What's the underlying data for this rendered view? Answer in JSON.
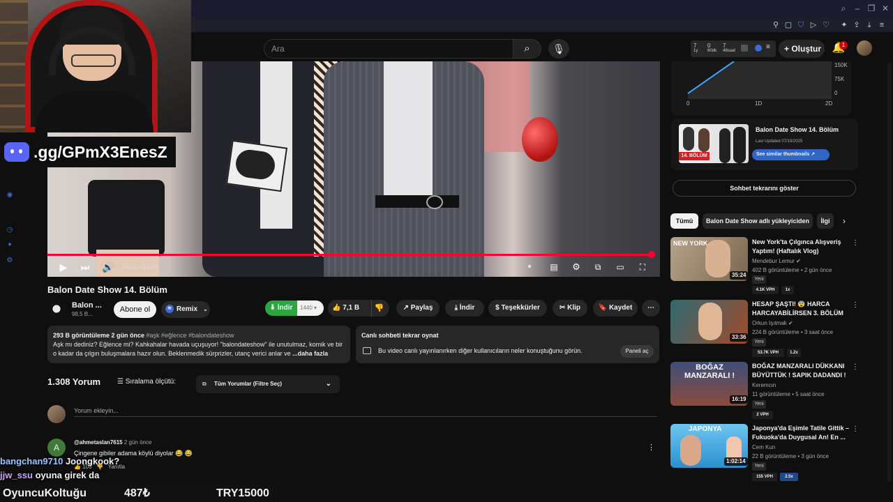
{
  "header": {
    "search_placeholder": "Ara",
    "create_label": "Oluştur",
    "notif_count": "1",
    "stats": [
      {
        "value": "7",
        "label": "1y"
      },
      {
        "value": "0",
        "label": "60dk."
      },
      {
        "value": "7",
        "label": "48saat"
      }
    ]
  },
  "overlay": {
    "discord_text": ".gg/GPmX3EnesZ",
    "chat": [
      {
        "user": "bangchan9710",
        "text": "Joongkook?"
      },
      {
        "user": "jjw_ssu",
        "text": "oyuna girek da"
      }
    ],
    "bottom_left": "OyuncuKoltuğu",
    "bottom_mid": "487₺",
    "bottom_right": "TRY15000"
  },
  "player": {
    "progress": 0.995,
    "time": "44:42 / 44:49"
  },
  "video": {
    "title": "Balon Date Show 14. Bölüm",
    "channel": "Balon ...",
    "subs": "98,5 B...",
    "subscribe_label": "Abone ol",
    "remix_label": "Remix",
    "download_label": "İndir",
    "download_count": "1440",
    "likes": "7,1 B",
    "share_label": "Paylaş",
    "download2_label": "İndir",
    "thanks_label": "Teşekkürler",
    "clip_label": "Klip",
    "save_label": "Kaydet"
  },
  "description": {
    "meta": "293 B görüntüleme  2 gün önce",
    "tags": "#aşk #eğlence #balondateshow",
    "text": "Aşk mı dediniz? Eğlence mi? Kahkahalar havada uçuşuyor! \"balondateshow\" ile unutulmaz, komik ve bir o kadar da çılgın buluşmalara hazır olun. Beklenmedik sürprizler, utanç verici anlar ve ",
    "more": "...daha fazla"
  },
  "live_chat": {
    "title": "Canlı sohbeti tekrar oynat",
    "text": "Bu video canlı yayınlanırken diğer kullanıcıların neler konuştuğunu görün.",
    "button": "Paneli aç"
  },
  "comments": {
    "count": "1.308 Yorum",
    "sort_label": "Sıralama ölçütü:",
    "filter_label": "Tüm Yorumlar (Filtre Seç)",
    "add_placeholder": "Yorum ekleyin...",
    "items": [
      {
        "avatar": "A",
        "user": "@ahmetaslan7615",
        "time": "2 gün önce",
        "text": "Çingene gibiler adama köylü diyolar 😂 😂",
        "likes": "103",
        "reply": "Yanıtla"
      }
    ]
  },
  "sidebar": {
    "chart": {
      "y_ticks": [
        "150K",
        "75K",
        "0"
      ],
      "x_ticks": [
        "0",
        "1D",
        "2D"
      ]
    },
    "thumb_card": {
      "title": "Balon Date Show 14. Bölüm",
      "updated": "Last Updated 07/19/2025",
      "button": "See similar thumbnails ↗",
      "badge": "14. BÖLÜM"
    },
    "show_chat": "Sohbet tekrarını göster",
    "chips": [
      "Tümü",
      "Balon Date Show adlı yükleyiciden",
      "İlgi"
    ],
    "recs": [
      {
        "title": "New York'ta Çılgınca Alışveriş Yaptım! (Haftalık Vlog)",
        "channel": "Mendebur Lemur ✔",
        "views": "402 B görüntüleme • 2 gün önce",
        "new": "Yeni",
        "vph": "4.1K VPH",
        "mult": "1x",
        "duration": "35:24",
        "thumb_text": "NEW YORK"
      },
      {
        "title": "HESAP ŞAŞTI! 😨 HARCA HARCAYABİLİRSEN 3. BÖLÜM",
        "channel": "Orkun Işıtmak ✔",
        "views": "224 B görüntüleme • 3 saat önce",
        "new": "Yeni",
        "vph": "53.7K VPH",
        "mult": "1.2x",
        "duration": "33:36",
        "thumb_text": ""
      },
      {
        "title": "BOĞAZ MANZARALI DÜKKANI BÜYÜTTÜK ! SAPIK DADANDI ! ...",
        "channel": "Keremcın",
        "views": "11 görüntüleme • 5 saat önce",
        "new": "Yeni",
        "vph": "2 VPH",
        "mult": "",
        "duration": "16:19",
        "thumb_text": "BOĞAZ MANZARALI !"
      },
      {
        "title": "Japonya'da Eşimle Tatile Gittik – Fukuoka'da Duygusal An! En ...",
        "channel": "Cem Kun",
        "views": "22 B görüntüleme • 3 gün önce",
        "new": "Yeni",
        "vph": "155 VPH",
        "mult": "2.5x",
        "duration": "1:02:14",
        "thumb_text": "JAPONYA"
      }
    ]
  }
}
